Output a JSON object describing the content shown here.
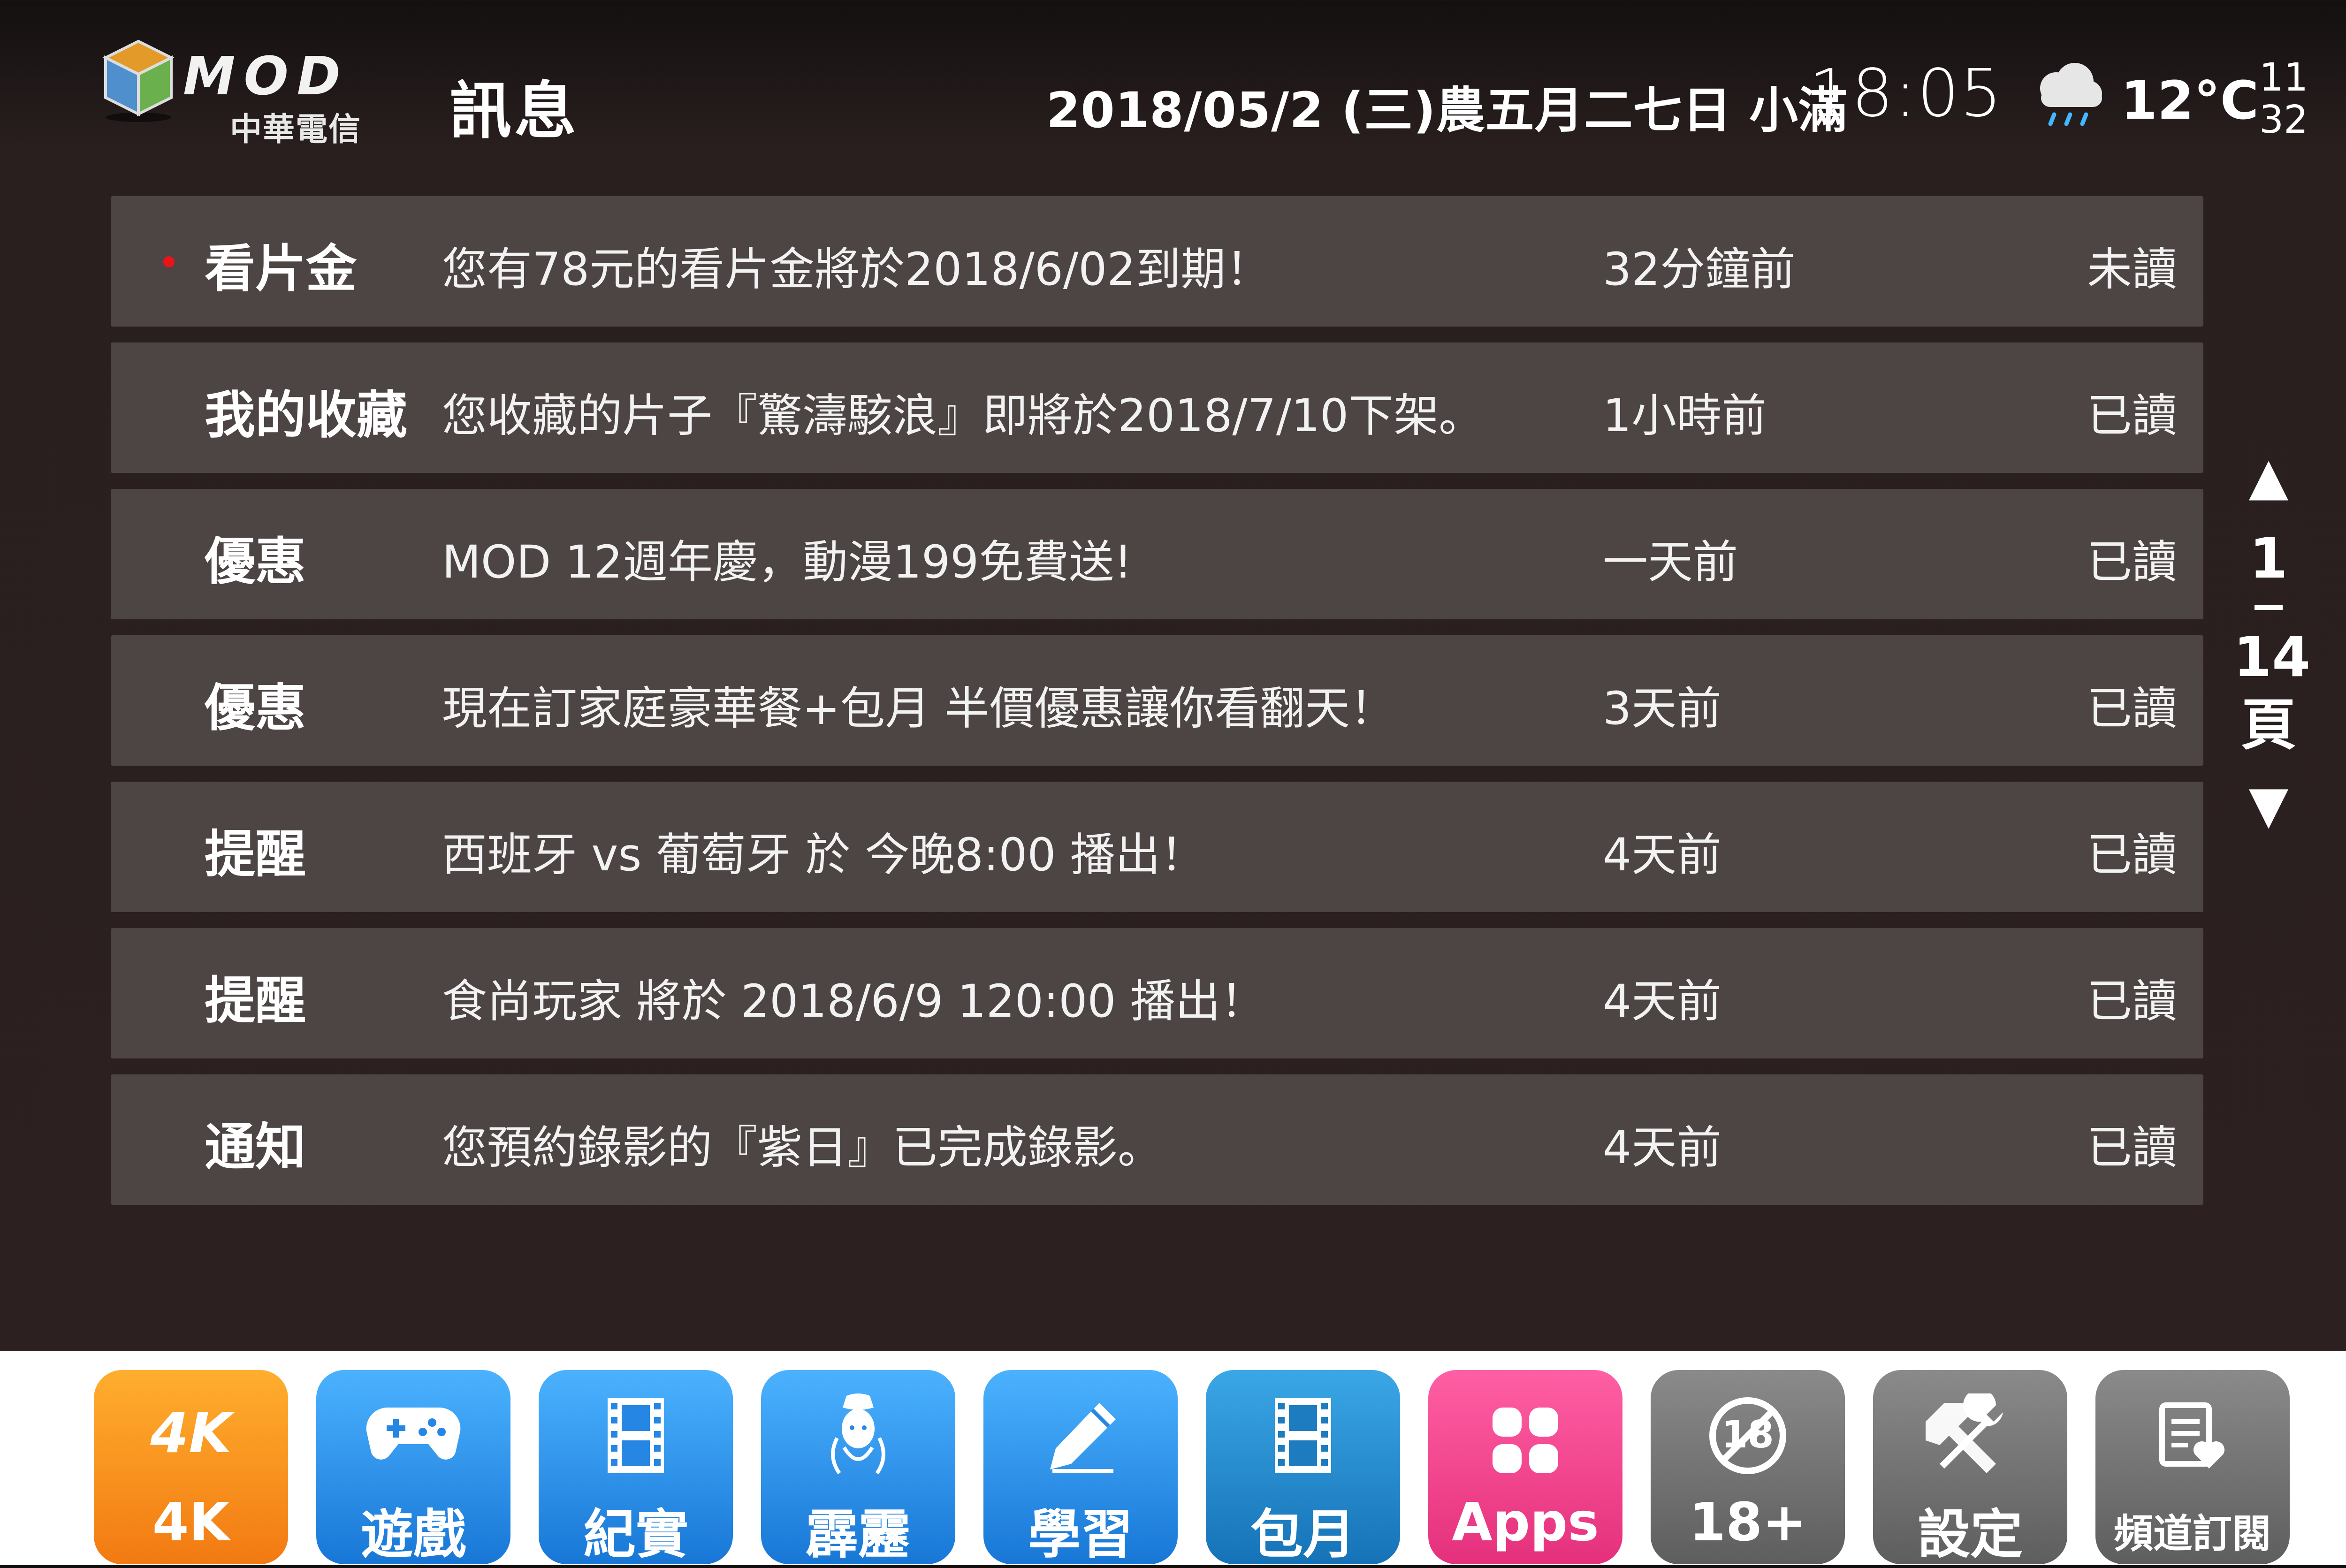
{
  "header": {
    "logo_brand": "MOD",
    "logo_company": "中華電信",
    "title": "訊息",
    "date_text": "2018/05/2 (三)農五月二七日 小滿",
    "time": "18:05",
    "weather_icon": "rain-cloud-icon",
    "temperature": "12°C",
    "temp_high": "11",
    "temp_low": "32"
  },
  "messages": [
    {
      "category": "看片金",
      "text": "您有78元的看片金將於2018/6/02到期！",
      "time": "32分鐘前",
      "status": "未讀",
      "unread": true
    },
    {
      "category": "我的收藏",
      "text": "您收藏的片子『驚濤駭浪』即將於2018/7/10下架。",
      "time": "1小時前",
      "status": "已讀",
      "unread": false
    },
    {
      "category": "優惠",
      "text": "MOD 12週年慶，動漫199免費送!",
      "time": "一天前",
      "status": "已讀",
      "unread": false
    },
    {
      "category": "優惠",
      "text": "現在訂家庭豪華餐+包月 半價優惠讓你看翻天！",
      "time": "3天前",
      "status": "已讀",
      "unread": false
    },
    {
      "category": "提醒",
      "text": "西班牙 vs 葡萄牙 於 今晚8:00 播出！",
      "time": "4天前",
      "status": "已讀",
      "unread": false
    },
    {
      "category": "提醒",
      "text": "食尚玩家 將於 2018/6/9 120:00 播出！",
      "time": "4天前",
      "status": "已讀",
      "unread": false
    },
    {
      "category": "通知",
      "text": "您預約錄影的『紫日』已完成錄影。",
      "time": "4天前",
      "status": "已讀",
      "unread": false
    }
  ],
  "pager": {
    "up_icon": "triangle-up-icon",
    "current": "1",
    "total": "14",
    "unit": "頁",
    "down_icon": "triangle-down-icon"
  },
  "dock": [
    {
      "label": "4K",
      "icon": "4k-icon",
      "color": "#f58a18"
    },
    {
      "label": "遊戲",
      "icon": "gamepad-icon",
      "color": "#2891ee"
    },
    {
      "label": "紀實",
      "icon": "film-strip-icon",
      "color": "#2891ee"
    },
    {
      "label": "霹靂",
      "icon": "puppet-icon",
      "color": "#2891ee"
    },
    {
      "label": "學習",
      "icon": "pencil-icon",
      "color": "#2891ee"
    },
    {
      "label": "包月",
      "icon": "film-strip-icon",
      "color": "#2589c8"
    },
    {
      "label": "Apps",
      "icon": "apps-grid-icon",
      "color": "#ee4590"
    },
    {
      "label": "18+",
      "icon": "no-18-icon",
      "color": "#707070"
    },
    {
      "label": "設定",
      "icon": "tools-icon",
      "color": "#707070"
    },
    {
      "label": "頻道訂閱",
      "icon": "subscribe-heart-icon",
      "color": "#707070"
    }
  ]
}
